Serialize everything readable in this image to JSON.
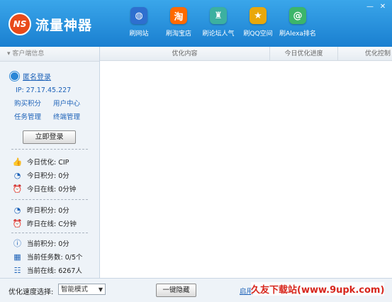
{
  "app": {
    "title": "流量神器",
    "logo_mark": "NS"
  },
  "nav": [
    {
      "label": "刷网站",
      "icon": "globe-icon",
      "glyph": "◍",
      "color": "#2e6fcf"
    },
    {
      "label": "刷淘宝店",
      "icon": "taobao-icon",
      "glyph": "淘",
      "color": "#ff6a00"
    },
    {
      "label": "刷论坛人气",
      "icon": "forum-icon",
      "glyph": "♜",
      "color": "#3cb0a0"
    },
    {
      "label": "刷QQ空间",
      "icon": "star-icon",
      "glyph": "★",
      "color": "#e9a80b"
    },
    {
      "label": "刷Alexa排名",
      "icon": "at-icon",
      "glyph": "@",
      "color": "#3cb56a"
    }
  ],
  "window": {
    "minimize": "—",
    "close": "✕"
  },
  "sidebar": {
    "header": "客户端信息",
    "user_link": "匿名登录",
    "ip": "IP: 27.17.45.227",
    "links": [
      "购买积分",
      "用户中心",
      "任务管理",
      "终端管理"
    ],
    "login_button": "立即登录",
    "stats_today": [
      {
        "icon": "thumb-up-icon",
        "text": "今日优化: CIP"
      },
      {
        "icon": "clock-icon",
        "text": "今日积分: 0分"
      },
      {
        "icon": "alarm-icon",
        "text": "今日在线: 0分钟"
      }
    ],
    "stats_yesterday": [
      {
        "icon": "clock-icon",
        "text": "昨日积分: 0分"
      },
      {
        "icon": "alarm-icon",
        "text": "昨日在线: C分钟"
      }
    ],
    "stats_current": [
      {
        "icon": "info-icon",
        "text": "当前积分: 0分"
      },
      {
        "icon": "tasks-icon",
        "text": "当前任务数: 0/5个"
      },
      {
        "icon": "users-icon",
        "text": "当前在线: 6267人"
      }
    ]
  },
  "table": {
    "columns": [
      "优化内容",
      "今日优化进度",
      "优化控制"
    ]
  },
  "footer": {
    "speed_label": "优化速度选择:",
    "speed_value": "智能模式",
    "hide_button": "一键隐藏",
    "start_link": "启用"
  },
  "watermark": "久友下载站(www.9upk.com)"
}
